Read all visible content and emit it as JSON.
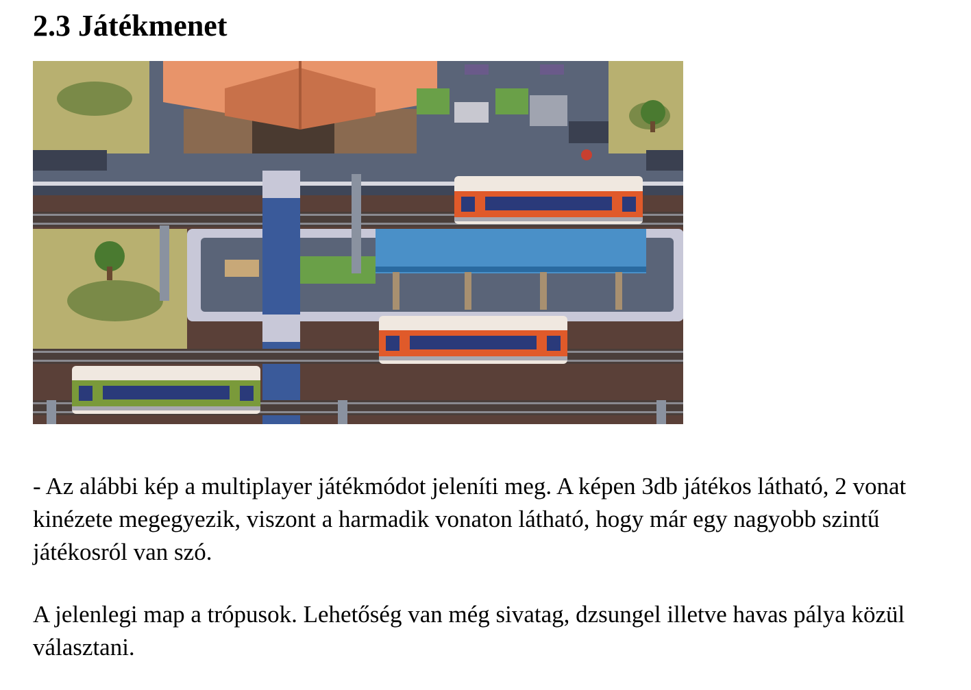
{
  "heading": "2.3 Játékmenet",
  "image": {
    "kind": "pixel-art railway station scene",
    "trains": [
      {
        "color": "orange",
        "track": "upper"
      },
      {
        "color": "orange",
        "track": "middle"
      },
      {
        "color": "green",
        "track": "lower"
      }
    ]
  },
  "paragraphs": [
    "- Az alábbi kép a multiplayer játékmódot jeleníti meg. A képen 3db játékos látható, 2 vonat kinézete megegyezik, viszont a harmadik vonaton látható, hogy már egy nagyobb szintű játékosról van szó.",
    "A jelenlegi map a trópusok. Lehetőség van még sivatag, dzsungel illetve havas pálya közül választani."
  ],
  "colors": {
    "grass": "#b8b070",
    "ground": "#5a4038",
    "platform": "#5a6478",
    "roof": "#e8946a",
    "canopy": "#4a90c8",
    "train_orange": "#e05a2a",
    "train_green": "#7a9a3a"
  }
}
